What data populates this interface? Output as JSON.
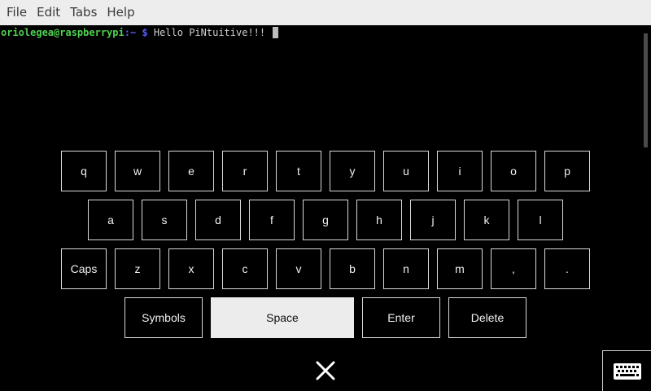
{
  "menubar": {
    "items": [
      "File",
      "Edit",
      "Tabs",
      "Help"
    ]
  },
  "terminal": {
    "user_host": "oriolegea@raspberrypi",
    "path": ":~",
    "dollar": " $",
    "command": " Hello PiNtuitive!!!"
  },
  "keyboard": {
    "row1": [
      "q",
      "w",
      "e",
      "r",
      "t",
      "y",
      "u",
      "i",
      "o",
      "p"
    ],
    "row2": [
      "a",
      "s",
      "d",
      "f",
      "g",
      "h",
      "j",
      "k",
      "l"
    ],
    "row3": [
      "Caps",
      "z",
      "x",
      "c",
      "v",
      "b",
      "n",
      "m",
      ",",
      "."
    ],
    "row4": {
      "symbols": "Symbols",
      "space": "Space",
      "enter": "Enter",
      "delete": "Delete"
    }
  },
  "icons": {
    "close": "close-icon",
    "keyboard": "keyboard-icon"
  }
}
